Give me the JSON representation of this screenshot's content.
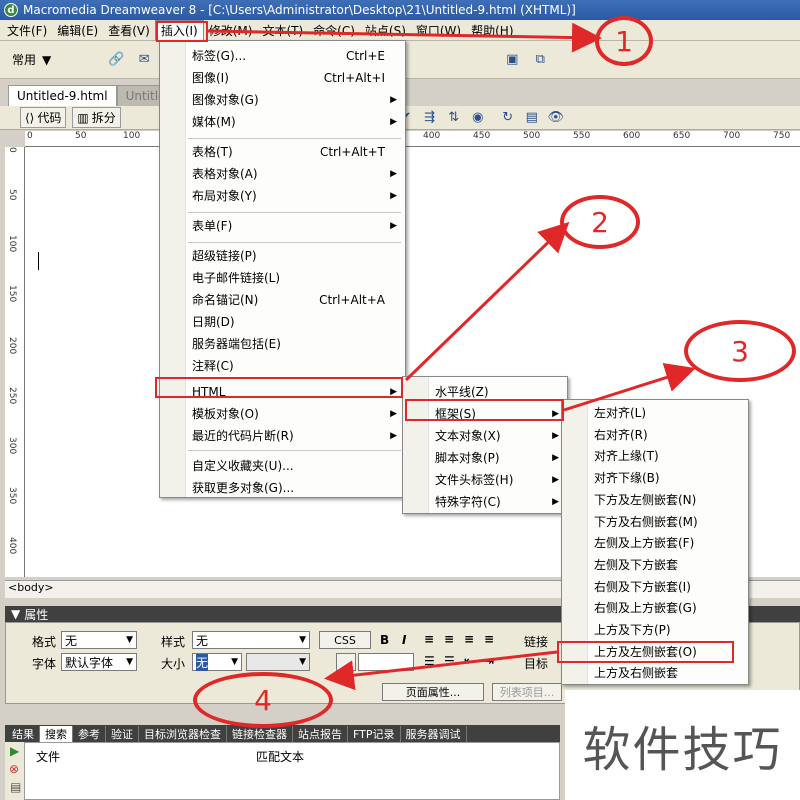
{
  "window": {
    "title": "Macromedia Dreamweaver 8 - [C:\\Users\\Administrator\\Desktop\\21\\Untitled-9.html (XHTML)]"
  },
  "menubar": [
    "文件(F)",
    "编辑(E)",
    "查看(V)",
    "插入(I)",
    "修改(M)",
    "文本(T)",
    "命令(C)",
    "站点(S)",
    "窗口(W)",
    "帮助(H)"
  ],
  "toolbar": {
    "category": "常用"
  },
  "doc_tabs": [
    "Untitled-9.html",
    "Untitled"
  ],
  "doc_toolbar": {
    "code": "代码",
    "split": "拆分"
  },
  "ruler_ticks": [
    "0",
    "50",
    "100",
    "150",
    "200",
    "250",
    "300",
    "350",
    "400",
    "450",
    "500",
    "550",
    "600",
    "650",
    "700",
    "750"
  ],
  "tag_selector": "<body>",
  "insert_menu": {
    "items": [
      {
        "label": "标签(G)...",
        "shortcut": "Ctrl+E",
        "sub": false
      },
      {
        "label": "图像(I)",
        "shortcut": "Ctrl+Alt+I",
        "sub": false
      },
      {
        "label": "图像对象(G)",
        "shortcut": "",
        "sub": true
      },
      {
        "label": "媒体(M)",
        "shortcut": "",
        "sub": true
      },
      {
        "label": "表格(T)",
        "shortcut": "Ctrl+Alt+T",
        "sub": false
      },
      {
        "label": "表格对象(A)",
        "shortcut": "",
        "sub": true
      },
      {
        "label": "布局对象(Y)",
        "shortcut": "",
        "sub": true
      },
      {
        "label": "表单(F)",
        "shortcut": "",
        "sub": true
      },
      {
        "label": "超级链接(P)",
        "shortcut": "",
        "sub": false
      },
      {
        "label": "电子邮件链接(L)",
        "shortcut": "",
        "sub": false
      },
      {
        "label": "命名锚记(N)",
        "shortcut": "Ctrl+Alt+A",
        "sub": false
      },
      {
        "label": "日期(D)",
        "shortcut": "",
        "sub": false
      },
      {
        "label": "服务器端包括(E)",
        "shortcut": "",
        "sub": false
      },
      {
        "label": "注释(C)",
        "shortcut": "",
        "sub": false
      },
      {
        "label": "HTML",
        "shortcut": "",
        "sub": true
      },
      {
        "label": "模板对象(O)",
        "shortcut": "",
        "sub": true
      },
      {
        "label": "最近的代码片断(R)",
        "shortcut": "",
        "sub": true
      },
      {
        "label": "自定义收藏夹(U)...",
        "shortcut": "",
        "sub": false
      },
      {
        "label": "获取更多对象(G)...",
        "shortcut": "",
        "sub": false
      }
    ]
  },
  "html_submenu": {
    "items": [
      {
        "label": "水平线(Z)",
        "sub": false
      },
      {
        "label": "框架(S)",
        "sub": true
      },
      {
        "label": "文本对象(X)",
        "sub": true
      },
      {
        "label": "脚本对象(P)",
        "sub": true
      },
      {
        "label": "文件头标签(H)",
        "sub": true
      },
      {
        "label": "特殊字符(C)",
        "sub": true
      }
    ]
  },
  "frames_submenu": {
    "items": [
      "左对齐(L)",
      "右对齐(R)",
      "对齐上缘(T)",
      "对齐下缘(B)",
      "下方及左侧嵌套(N)",
      "下方及右侧嵌套(M)",
      "左侧及上方嵌套(F)",
      "左侧及下方嵌套",
      "右侧及下方嵌套(I)",
      "右侧及上方嵌套(G)",
      "上方及下方(P)",
      "上方及左侧嵌套(O)",
      "上方及右侧嵌套"
    ]
  },
  "properties": {
    "header": "属性",
    "format_label": "格式",
    "format_value": "无",
    "style_label": "样式",
    "style_value": "无",
    "css_button": "CSS",
    "bold": "B",
    "italic": "I",
    "link_label": "链接",
    "font_label": "字体",
    "font_value": "默认字体",
    "size_label": "大小",
    "size_value": "无",
    "target_label": "目标",
    "page_props_button": "页面属性...",
    "list_item_button": "列表项目..."
  },
  "results": {
    "label": "结果",
    "tabs": [
      "搜索",
      "参考",
      "验证",
      "目标浏览器检查",
      "链接检查器",
      "站点报告",
      "FTP记录",
      "服务器调试"
    ],
    "col_file": "文件",
    "col_match": "匹配文本"
  },
  "annotations": [
    "1",
    "2",
    "3",
    "4"
  ],
  "watermark": "软件技巧",
  "colors": {
    "annotation_red": "#e02828",
    "title_blue": "#2a5aa6"
  }
}
